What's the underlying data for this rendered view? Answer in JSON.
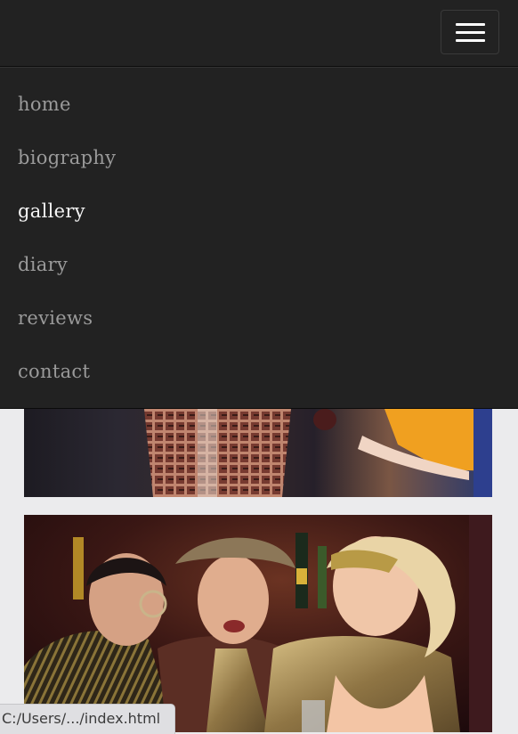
{
  "nav": {
    "items": [
      {
        "label": "home",
        "active": false
      },
      {
        "label": "biography",
        "active": false
      },
      {
        "label": "gallery",
        "active": true
      },
      {
        "label": "diary",
        "active": false
      },
      {
        "label": "reviews",
        "active": false
      },
      {
        "label": "contact",
        "active": false
      }
    ],
    "toggle_icon": "hamburger-icon"
  },
  "colors": {
    "navbar_bg": "#222222",
    "menu_text": "#9a9a9a",
    "menu_active_text": "#f5f5f5",
    "page_bg": "#ebebed"
  },
  "status_bar": {
    "url": "C:/Users/.../index.html"
  }
}
